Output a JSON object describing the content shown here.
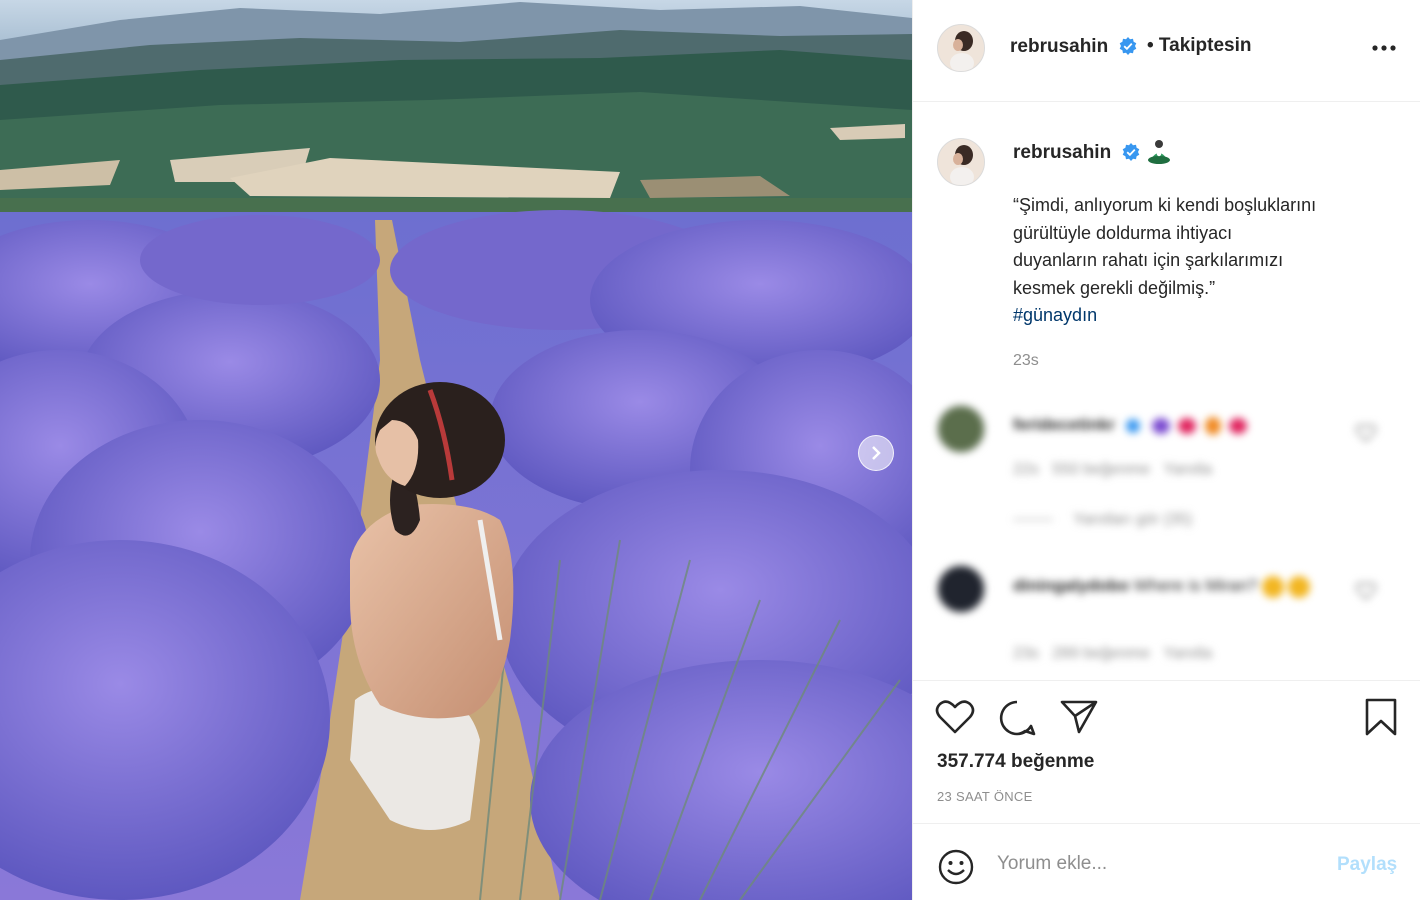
{
  "post": {
    "username": "rebrusahin",
    "follow_status": "• Takiptesin",
    "caption_lines": [
      "“Şimdi, anlıyorum ki kendi boşluklarını",
      "gürültüyle doldurma ihtiyacı",
      "duyanların rahatı için şarkılarımızı",
      "kesmek gerekli değilmiş.”"
    ],
    "hashtag": "#günaydın",
    "caption_time": "23s",
    "likes": "357.774 beğenme",
    "time_ago": "23 SAAT ÖNCE"
  },
  "comments": [
    {
      "username": "feridecetinkr",
      "time": "22s",
      "likes": "550 beğenme",
      "reply": "Yanıtla",
      "view_replies": "Yanıtları gör (35)"
    },
    {
      "username": "diningalydobo",
      "text": "Where is Miran?",
      "time": "23s",
      "likes": "289 beğenme",
      "reply": "Yanıtla"
    }
  ],
  "comment_box": {
    "placeholder": "Yorum ekle...",
    "post_label": "Paylaş"
  },
  "icons": {
    "verified": "verified-badge-icon",
    "more": "more-options-icon",
    "like": "heart-icon",
    "comment": "comment-bubble-icon",
    "share": "paper-plane-icon",
    "save": "bookmark-icon",
    "emoji": "emoji-smile-icon",
    "carousel_next": "chevron-right-icon"
  },
  "colors": {
    "verified": "#3897f0",
    "link": "#00376b",
    "muted": "#8e8e8e",
    "post_disabled": "#b2dffc"
  }
}
